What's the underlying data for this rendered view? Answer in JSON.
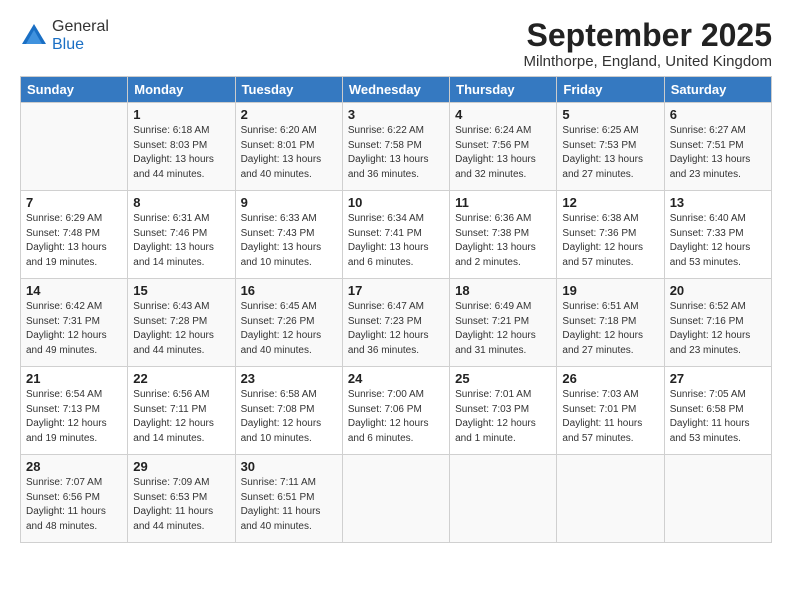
{
  "header": {
    "logo": {
      "general": "General",
      "blue": "Blue"
    },
    "title": "September 2025",
    "location": "Milnthorpe, England, United Kingdom"
  },
  "days_of_week": [
    "Sunday",
    "Monday",
    "Tuesday",
    "Wednesday",
    "Thursday",
    "Friday",
    "Saturday"
  ],
  "weeks": [
    [
      {
        "day": "",
        "sunrise": "",
        "sunset": "",
        "daylight": ""
      },
      {
        "day": "1",
        "sunrise": "Sunrise: 6:18 AM",
        "sunset": "Sunset: 8:03 PM",
        "daylight": "Daylight: 13 hours and 44 minutes."
      },
      {
        "day": "2",
        "sunrise": "Sunrise: 6:20 AM",
        "sunset": "Sunset: 8:01 PM",
        "daylight": "Daylight: 13 hours and 40 minutes."
      },
      {
        "day": "3",
        "sunrise": "Sunrise: 6:22 AM",
        "sunset": "Sunset: 7:58 PM",
        "daylight": "Daylight: 13 hours and 36 minutes."
      },
      {
        "day": "4",
        "sunrise": "Sunrise: 6:24 AM",
        "sunset": "Sunset: 7:56 PM",
        "daylight": "Daylight: 13 hours and 32 minutes."
      },
      {
        "day": "5",
        "sunrise": "Sunrise: 6:25 AM",
        "sunset": "Sunset: 7:53 PM",
        "daylight": "Daylight: 13 hours and 27 minutes."
      },
      {
        "day": "6",
        "sunrise": "Sunrise: 6:27 AM",
        "sunset": "Sunset: 7:51 PM",
        "daylight": "Daylight: 13 hours and 23 minutes."
      }
    ],
    [
      {
        "day": "7",
        "sunrise": "Sunrise: 6:29 AM",
        "sunset": "Sunset: 7:48 PM",
        "daylight": "Daylight: 13 hours and 19 minutes."
      },
      {
        "day": "8",
        "sunrise": "Sunrise: 6:31 AM",
        "sunset": "Sunset: 7:46 PM",
        "daylight": "Daylight: 13 hours and 14 minutes."
      },
      {
        "day": "9",
        "sunrise": "Sunrise: 6:33 AM",
        "sunset": "Sunset: 7:43 PM",
        "daylight": "Daylight: 13 hours and 10 minutes."
      },
      {
        "day": "10",
        "sunrise": "Sunrise: 6:34 AM",
        "sunset": "Sunset: 7:41 PM",
        "daylight": "Daylight: 13 hours and 6 minutes."
      },
      {
        "day": "11",
        "sunrise": "Sunrise: 6:36 AM",
        "sunset": "Sunset: 7:38 PM",
        "daylight": "Daylight: 13 hours and 2 minutes."
      },
      {
        "day": "12",
        "sunrise": "Sunrise: 6:38 AM",
        "sunset": "Sunset: 7:36 PM",
        "daylight": "Daylight: 12 hours and 57 minutes."
      },
      {
        "day": "13",
        "sunrise": "Sunrise: 6:40 AM",
        "sunset": "Sunset: 7:33 PM",
        "daylight": "Daylight: 12 hours and 53 minutes."
      }
    ],
    [
      {
        "day": "14",
        "sunrise": "Sunrise: 6:42 AM",
        "sunset": "Sunset: 7:31 PM",
        "daylight": "Daylight: 12 hours and 49 minutes."
      },
      {
        "day": "15",
        "sunrise": "Sunrise: 6:43 AM",
        "sunset": "Sunset: 7:28 PM",
        "daylight": "Daylight: 12 hours and 44 minutes."
      },
      {
        "day": "16",
        "sunrise": "Sunrise: 6:45 AM",
        "sunset": "Sunset: 7:26 PM",
        "daylight": "Daylight: 12 hours and 40 minutes."
      },
      {
        "day": "17",
        "sunrise": "Sunrise: 6:47 AM",
        "sunset": "Sunset: 7:23 PM",
        "daylight": "Daylight: 12 hours and 36 minutes."
      },
      {
        "day": "18",
        "sunrise": "Sunrise: 6:49 AM",
        "sunset": "Sunset: 7:21 PM",
        "daylight": "Daylight: 12 hours and 31 minutes."
      },
      {
        "day": "19",
        "sunrise": "Sunrise: 6:51 AM",
        "sunset": "Sunset: 7:18 PM",
        "daylight": "Daylight: 12 hours and 27 minutes."
      },
      {
        "day": "20",
        "sunrise": "Sunrise: 6:52 AM",
        "sunset": "Sunset: 7:16 PM",
        "daylight": "Daylight: 12 hours and 23 minutes."
      }
    ],
    [
      {
        "day": "21",
        "sunrise": "Sunrise: 6:54 AM",
        "sunset": "Sunset: 7:13 PM",
        "daylight": "Daylight: 12 hours and 19 minutes."
      },
      {
        "day": "22",
        "sunrise": "Sunrise: 6:56 AM",
        "sunset": "Sunset: 7:11 PM",
        "daylight": "Daylight: 12 hours and 14 minutes."
      },
      {
        "day": "23",
        "sunrise": "Sunrise: 6:58 AM",
        "sunset": "Sunset: 7:08 PM",
        "daylight": "Daylight: 12 hours and 10 minutes."
      },
      {
        "day": "24",
        "sunrise": "Sunrise: 7:00 AM",
        "sunset": "Sunset: 7:06 PM",
        "daylight": "Daylight: 12 hours and 6 minutes."
      },
      {
        "day": "25",
        "sunrise": "Sunrise: 7:01 AM",
        "sunset": "Sunset: 7:03 PM",
        "daylight": "Daylight: 12 hours and 1 minute."
      },
      {
        "day": "26",
        "sunrise": "Sunrise: 7:03 AM",
        "sunset": "Sunset: 7:01 PM",
        "daylight": "Daylight: 11 hours and 57 minutes."
      },
      {
        "day": "27",
        "sunrise": "Sunrise: 7:05 AM",
        "sunset": "Sunset: 6:58 PM",
        "daylight": "Daylight: 11 hours and 53 minutes."
      }
    ],
    [
      {
        "day": "28",
        "sunrise": "Sunrise: 7:07 AM",
        "sunset": "Sunset: 6:56 PM",
        "daylight": "Daylight: 11 hours and 48 minutes."
      },
      {
        "day": "29",
        "sunrise": "Sunrise: 7:09 AM",
        "sunset": "Sunset: 6:53 PM",
        "daylight": "Daylight: 11 hours and 44 minutes."
      },
      {
        "day": "30",
        "sunrise": "Sunrise: 7:11 AM",
        "sunset": "Sunset: 6:51 PM",
        "daylight": "Daylight: 11 hours and 40 minutes."
      },
      {
        "day": "",
        "sunrise": "",
        "sunset": "",
        "daylight": ""
      },
      {
        "day": "",
        "sunrise": "",
        "sunset": "",
        "daylight": ""
      },
      {
        "day": "",
        "sunrise": "",
        "sunset": "",
        "daylight": ""
      },
      {
        "day": "",
        "sunrise": "",
        "sunset": "",
        "daylight": ""
      }
    ]
  ]
}
